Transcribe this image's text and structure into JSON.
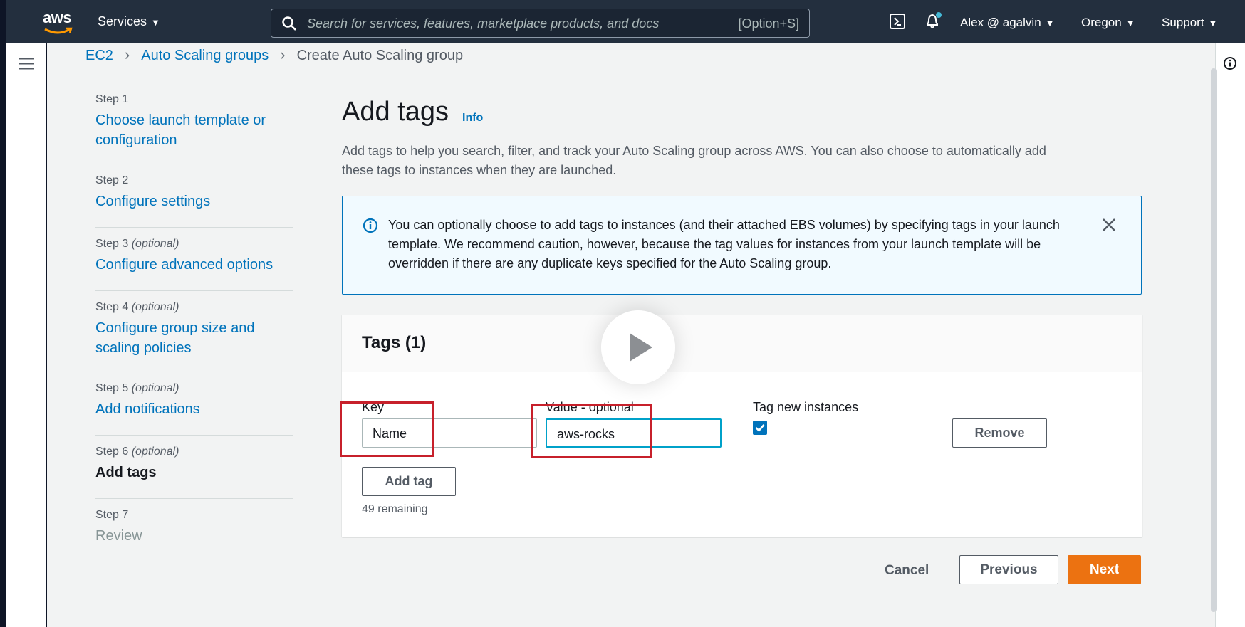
{
  "nav": {
    "logo": "aws",
    "services": "Services",
    "search_placeholder": "Search for services, features, marketplace products, and docs",
    "search_shortcut": "[Option+S]",
    "user": "Alex @ agalvin",
    "region": "Oregon",
    "support": "Support"
  },
  "breadcrumb": {
    "items": [
      "EC2",
      "Auto Scaling groups"
    ],
    "current": "Create Auto Scaling group"
  },
  "steps": [
    {
      "label": "Step 1",
      "optional": "",
      "name_lines": [
        "Choose launch template or",
        "configuration"
      ]
    },
    {
      "label": "Step 2",
      "optional": "",
      "name_lines": [
        "Configure settings"
      ]
    },
    {
      "label": "Step 3",
      "optional": "(optional)",
      "name_lines": [
        "Configure advanced options"
      ]
    },
    {
      "label": "Step 4",
      "optional": "(optional)",
      "name_lines": [
        "Configure group size and",
        "scaling policies"
      ]
    },
    {
      "label": "Step 5",
      "optional": "(optional)",
      "name_lines": [
        "Add notifications"
      ]
    },
    {
      "label": "Step 6",
      "optional": "(optional)",
      "name_lines": [
        "Add tags"
      ]
    },
    {
      "label": "Step 7",
      "optional": "",
      "name_lines": [
        "Review"
      ]
    }
  ],
  "page": {
    "title": "Add tags",
    "info": "Info",
    "description": "Add tags to help you search, filter, and track your Auto Scaling group across AWS. You can also choose to automatically add these tags to instances when they are launched."
  },
  "alert": {
    "text": "You can optionally choose to add tags to instances (and their attached EBS volumes) by specifying tags in your launch template. We recommend caution, however, because the tag values for instances from your launch template will be overridden if there are any duplicate keys specified for the Auto Scaling group."
  },
  "tags": {
    "heading": "Tags (1)",
    "key_label": "Key",
    "value_label": "Value - optional",
    "tag_new_label": "Tag new instances",
    "key_value": "Name",
    "value_value": "aws-rocks",
    "remove": "Remove",
    "add_tag": "Add tag",
    "remaining": "49 remaining"
  },
  "footer": {
    "cancel": "Cancel",
    "previous": "Previous",
    "next": "Next"
  },
  "colors": {
    "nav_bg": "#232f3e",
    "link": "#0073bb",
    "primary_button": "#ec7211",
    "highlight_box": "#c7202b"
  }
}
